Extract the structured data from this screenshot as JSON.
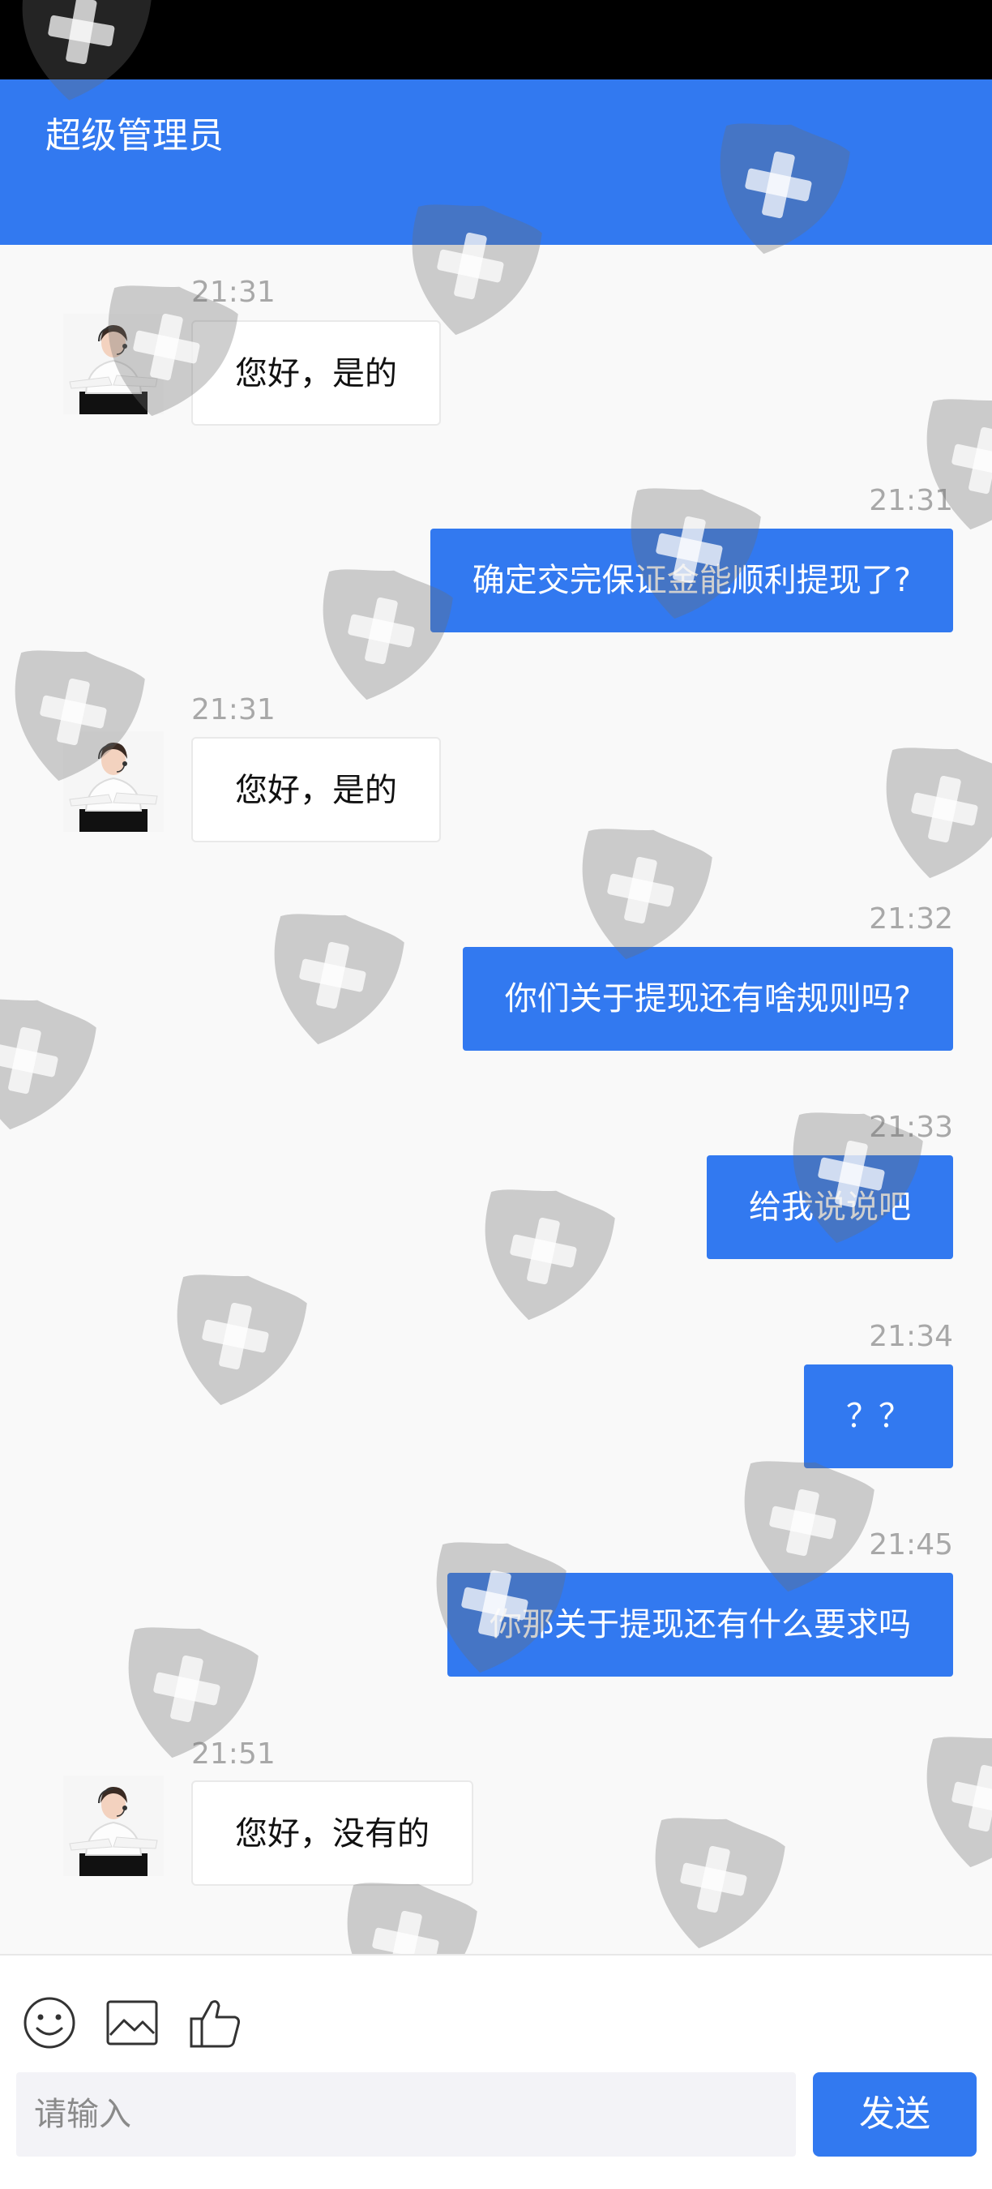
{
  "app": {
    "title": "超级管理员",
    "accent_color": "#3279f0"
  },
  "messages": [
    {
      "side": "in",
      "time": "21:31",
      "text": "您好，是的",
      "avatar": "agent-avatar"
    },
    {
      "side": "out",
      "time": "21:31",
      "text": "确定交完保证金能顺利提现了?"
    },
    {
      "side": "in",
      "time": "21:31",
      "text": "您好，是的",
      "avatar": "agent-avatar"
    },
    {
      "side": "out",
      "time": "21:32",
      "text": "你们关于提现还有啥规则吗?"
    },
    {
      "side": "out",
      "time": "21:33",
      "text": "给我说说吧"
    },
    {
      "side": "out",
      "time": "21:34",
      "text": "？？"
    },
    {
      "side": "out",
      "time": "21:45",
      "text": "你那关于提现还有什么要求吗"
    },
    {
      "side": "in",
      "time": "21:51",
      "text": "您好，没有的",
      "avatar": "agent-avatar"
    }
  ],
  "composer": {
    "tools": [
      "emoji-icon",
      "image-icon",
      "thumbs-up-icon"
    ],
    "placeholder": "请输入",
    "value": "",
    "send_label": "发送"
  }
}
